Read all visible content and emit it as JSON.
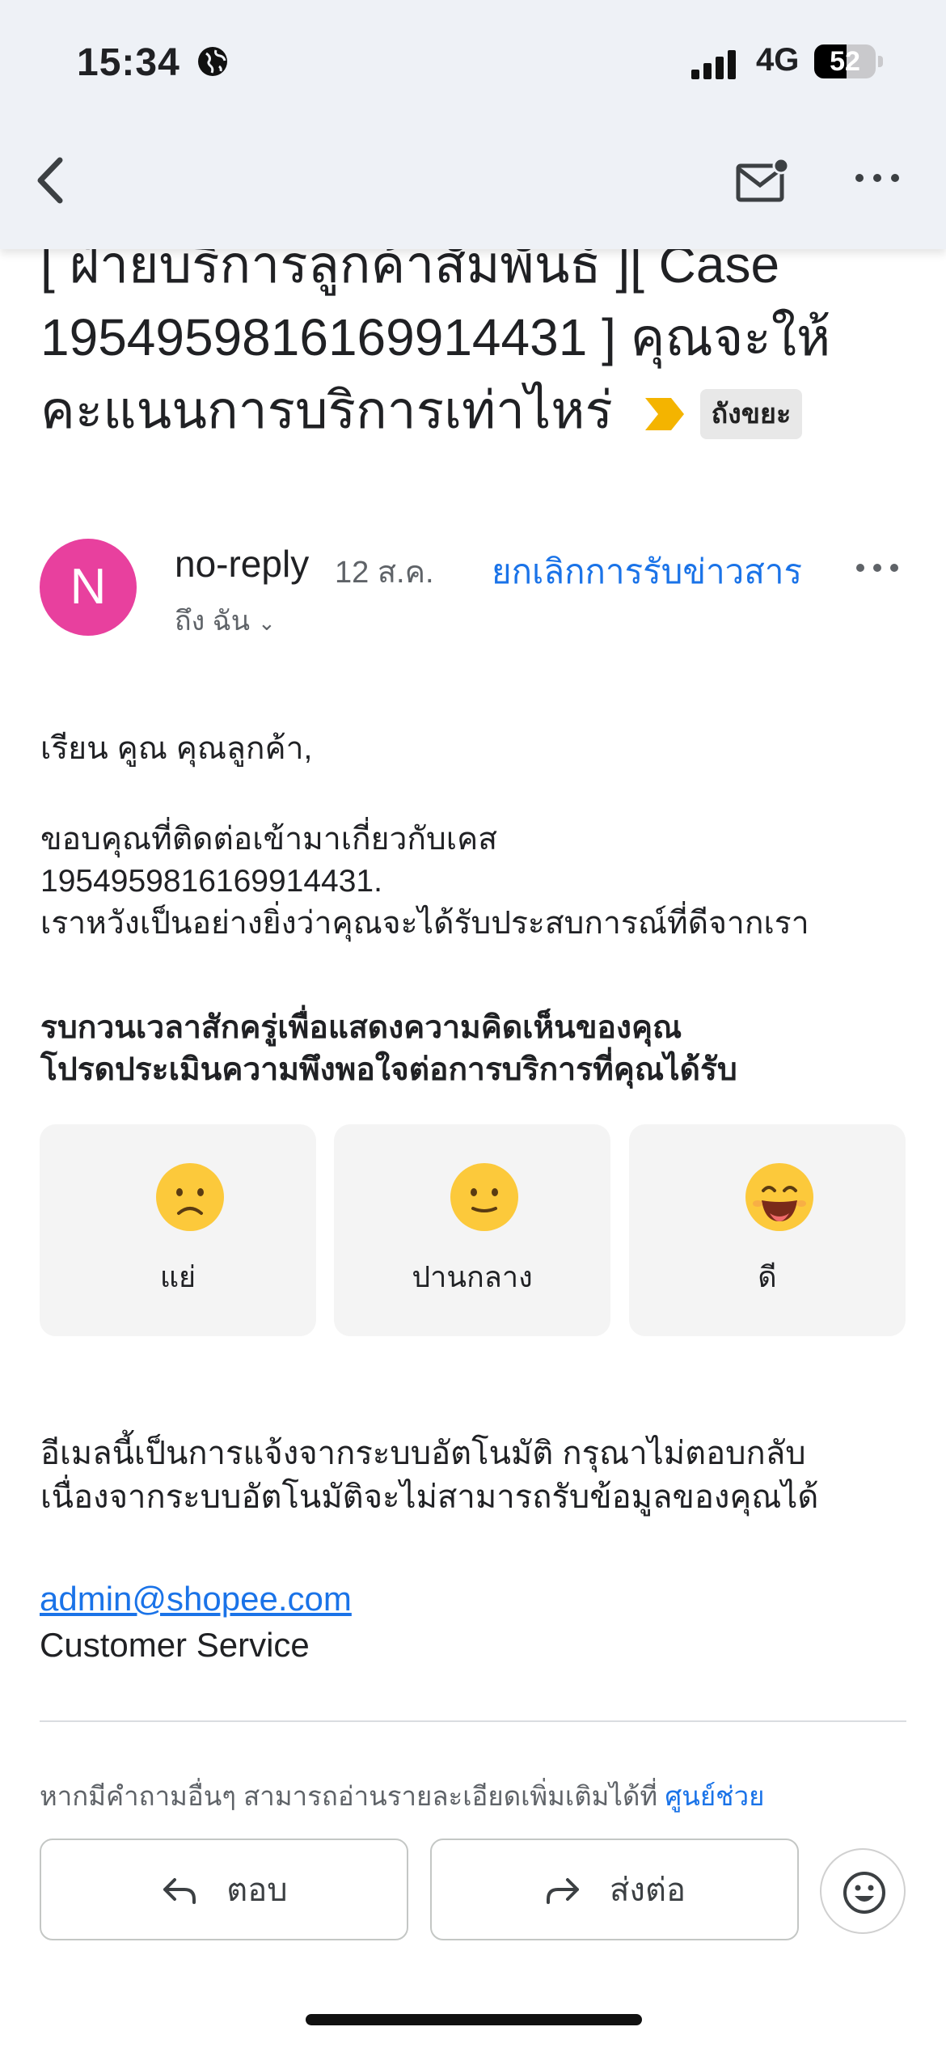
{
  "status_bar": {
    "time": "15:34",
    "network": "4G",
    "battery_level": "52",
    "battery_fraction": 0.52
  },
  "subject": {
    "text": "[ ฝ่ายบริการลูกค้าสัมพันธ์ ][ Case 1954959816169914431 ] คุณจะให้คะแนนการบริการเท่าไหร่",
    "label": "ถังขยะ"
  },
  "sender": {
    "initial": "N",
    "name": "no-reply",
    "date": "12 ส.ค.",
    "recipient": "ถึง ฉัน",
    "unsubscribe": "ยกเลิกการรับข่าวสาร"
  },
  "body": {
    "greeting": "เรียน คูณ คุณลูกค้า,",
    "para1": "ขอบคุณที่ติดต่อเข้ามาเกี่ยวกับเคส\n1954959816169914431.\nเราหวังเป็นอย่างยิ่งว่าคุณจะได้รับประสบการณ์ที่ดีจากเรา",
    "bold_prompt": "รบกวนเวลาสักครู่เพื่อแสดงความคิดเห็นของคุณ\nโปรดประเมินความพึงพอใจต่อการบริการที่คุณได้รับ",
    "ratings": [
      "แย่",
      "ปานกลาง",
      "ดี"
    ],
    "auto_notice": "อีเมลนี้เป็นการแจ้งจากระบบอัตโนมัติ กรุณาไม่ตอบกลับ\nเนื่องจากระบบอัตโนมัติจะไม่สามารถรับข้อมูลของคุณได้",
    "email_link": "admin@shopee.com",
    "signature": "Customer Service"
  },
  "footer": {
    "note": "หากมีคำถามอื่นๆ สามารถอ่านรายละเอียดเพิ่มเติมได้ที่",
    "help_link": "ศูนย์ช่วย"
  },
  "actions": {
    "reply": "ตอบ",
    "forward": "ส่งต่อ"
  },
  "icons": {
    "back": "back-chevron-icon",
    "mail": "mark-unread-icon",
    "more": "more-horizontal-icon",
    "label_tag": "importance-marker-icon",
    "reply": "reply-arrow-icon",
    "forward": "forward-arrow-icon",
    "emoji": "add-reaction-icon"
  },
  "colors": {
    "avatar": "#e8409e",
    "link": "#1a73e8",
    "importance": "#f4b400",
    "emoji_face": "#fcc93b"
  }
}
